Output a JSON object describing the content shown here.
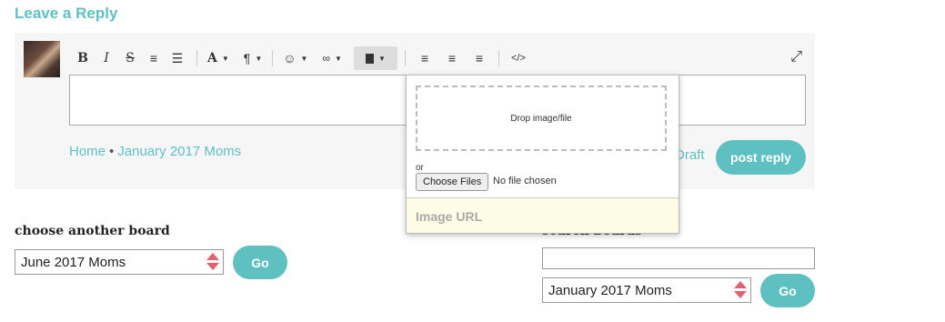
{
  "reply": {
    "heading": "Leave a Reply",
    "toolbar": {
      "bold": "B",
      "italic": "I",
      "strike": "S",
      "ordered_list": "≡",
      "unordered_list": "☰",
      "font": "A",
      "paragraph": "¶",
      "emoji": "☺",
      "link": "🔗",
      "file": "▮",
      "align_left": "≡",
      "align_center": "≡",
      "align_right": "≡",
      "code": "</>",
      "caret": "▼",
      "expand": "⤢"
    },
    "breadcrumb": {
      "home": "Home",
      "board": "January 2017 Moms",
      "separator": "•"
    },
    "draft_label": "Draft",
    "post_label": "post reply"
  },
  "file_popup": {
    "drop_text": "Drop image/file",
    "or_text": "or",
    "choose_label": "Choose Files",
    "no_file_text": "No file chosen",
    "url_placeholder": "Image URL"
  },
  "board_chooser": {
    "label": "choose another board",
    "selected": "June 2017 Moms",
    "go_label": "Go"
  },
  "search_boards": {
    "label": "search boards",
    "selected": "January 2017 Moms",
    "go_label": "Go"
  },
  "colors": {
    "accent": "#5fc0c2",
    "arrow": "#e0626e",
    "panel": "#f6f6f6"
  }
}
